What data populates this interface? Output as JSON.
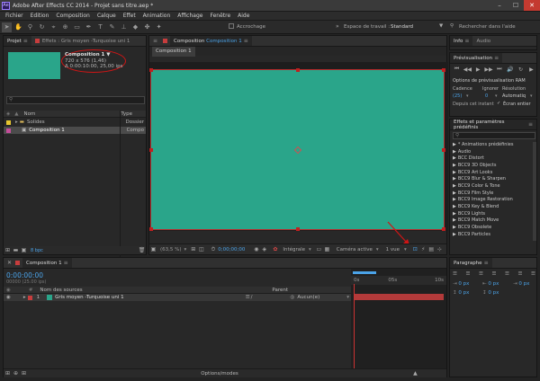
{
  "window": {
    "title": "Adobe After Effects CC 2014 - Projet sans titre.aep *"
  },
  "menu": [
    "Fichier",
    "Edition",
    "Composition",
    "Calque",
    "Effet",
    "Animation",
    "Affichage",
    "Fenêtre",
    "Aide"
  ],
  "toolbar": {
    "snap_label": "Accrochage",
    "workspace_label": "Espace de travail :",
    "workspace_value": "Standard",
    "search_placeholder": "Rechercher dans l'aide"
  },
  "project_panel": {
    "tab": "Projet",
    "effects_tab": "Effets : Gris moyen -Turquoise uni 1",
    "thumb_color": "#2aa58a",
    "comp_name": "Composition 1 ▼",
    "comp_size": "720 x 576 (1,46)",
    "comp_duration": "Δ 0:00:10:00, 25,00 ips",
    "col_name": "Nom",
    "col_type": "Type",
    "items": [
      {
        "name": "Solides",
        "type": "Dossier"
      },
      {
        "name": "Composition 1",
        "type": "Compo"
      }
    ],
    "bpc": "8 bpc"
  },
  "viewer": {
    "tab_label": "Composition",
    "tab_name": "Composition 1",
    "sub_tab": "Composition 1",
    "canvas_color": "#2aa58a",
    "zoom": "(63,5 %)",
    "time": "0;00;00;00",
    "resolution": "Intégrale",
    "camera": "Caméra active",
    "views": "1 vue"
  },
  "info_panel": {
    "tab_info": "Info",
    "tab_audio": "Audio"
  },
  "preview_panel": {
    "title": "Prévisualisation",
    "ram_options": "Options de prévisualisation RAM",
    "cadence_label": "Cadence",
    "ignore_label": "Ignorer",
    "resolution_label": "Résolution",
    "cadence_value": "(25)",
    "ignore_value": "0",
    "resolution_value": "Automatiq",
    "from_current": "Depuis cet instant",
    "full_screen": "Écran entier"
  },
  "effects_panel": {
    "title": "Effets et paramètres prédéfinis",
    "items": [
      "* Animations prédéfinies",
      "Audio",
      "BCC Distort",
      "BCC9 3D Objects",
      "BCC9 Art Looks",
      "BCC9 Blur & Sharpen",
      "BCC9 Color & Tone",
      "BCC9 Film Style",
      "BCC9 Image Restoration",
      "BCC9 Key & Blend",
      "BCC9 Lights",
      "BCC9 Match Move",
      "BCC9 Obsolete",
      "BCC9 Particles"
    ]
  },
  "timeline": {
    "tab": "Composition 1",
    "timecode": "0:00:00:00",
    "fps": "00000 (25.00 ips)",
    "col_layer": "Nom des sources",
    "col_parent": "Parent",
    "layer_num": "1",
    "layer_name": "Gris moyen -Turquoise uni 1",
    "layer_parent": "Aucun(e)",
    "ruler": [
      "0s",
      "05s",
      "10s"
    ],
    "bottom_label": "Options/modes"
  },
  "paragraph_panel": {
    "title": "Paragraphe",
    "values": [
      "0 px",
      "0 px",
      "0 px",
      "0 px",
      "0 px"
    ]
  }
}
